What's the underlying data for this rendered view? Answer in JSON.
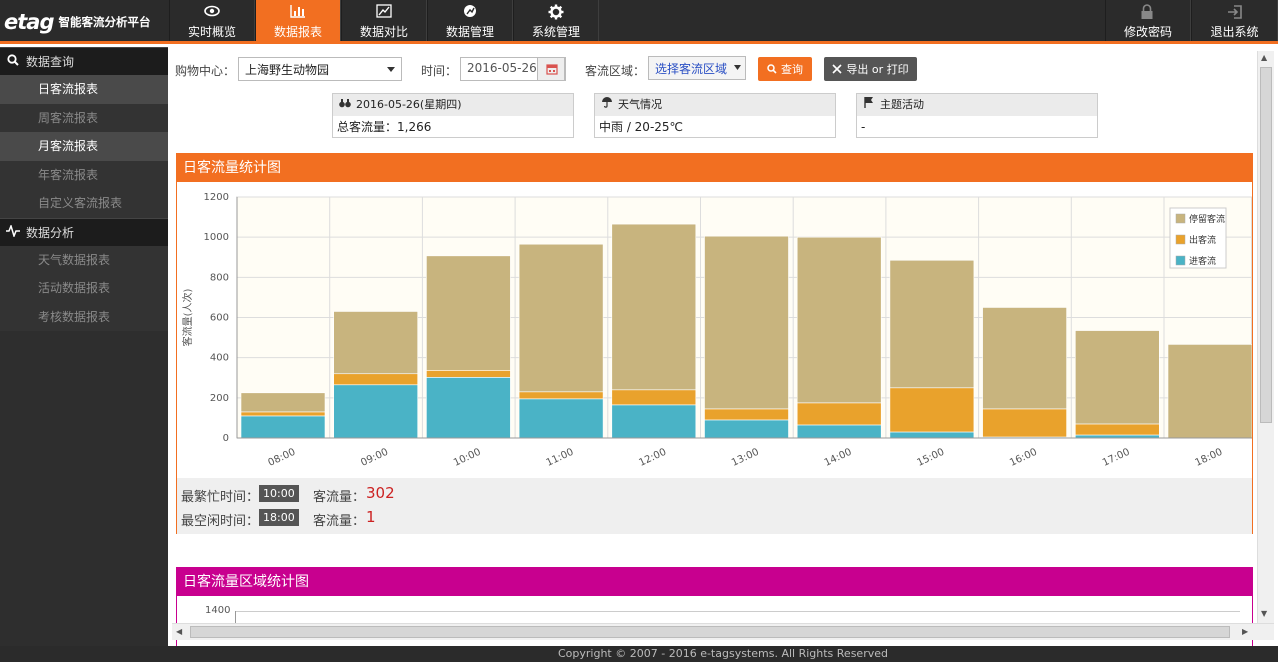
{
  "app": {
    "logo_mark": "etag",
    "logo_text": "智能客流分析平台"
  },
  "nav": {
    "items": [
      {
        "label": "实时概览",
        "icon": "eye-icon"
      },
      {
        "label": "数据报表",
        "icon": "bar-chart-icon",
        "active": true
      },
      {
        "label": "数据对比",
        "icon": "compare-icon"
      },
      {
        "label": "数据管理",
        "icon": "manage-icon"
      },
      {
        "label": "系统管理",
        "icon": "gear-icon"
      }
    ],
    "right": [
      {
        "label": "修改密码",
        "icon": "lock-icon"
      },
      {
        "label": "退出系统",
        "icon": "logout-icon"
      }
    ]
  },
  "sidebar": {
    "sections": [
      {
        "label": "数据查询",
        "icon": "search-icon",
        "items": [
          "日客流报表",
          "周客流报表",
          "月客流报表",
          "年客流报表",
          "自定义客流报表"
        ]
      },
      {
        "label": "数据分析",
        "icon": "pulse-icon",
        "items": [
          "天气数据报表",
          "活动数据报表",
          "考核数据报表"
        ]
      }
    ]
  },
  "filters": {
    "mall_label": "购物中心：",
    "mall_value": "上海野生动物园",
    "time_label": "时间：",
    "time_value": "2016-05-26",
    "area_label": "客流区域：",
    "area_value": "选择客流区域",
    "query_label": "查询",
    "export_label": "导出 or 打印"
  },
  "info": {
    "date_header": "2016-05-26(星期四)",
    "total_text": "总客流量：1,266",
    "weather_header": "天气情况",
    "weather_text": "中雨 / 20-25℃",
    "activity_header": "主题活动",
    "activity_text": "-"
  },
  "panel1": {
    "title": "日客流量统计图",
    "busiest_label": "最繁忙时间：",
    "busiest_time": "10:00",
    "busiest_count_label": "客流量：",
    "busiest_count": "302",
    "idlest_label": "最空闲时间：",
    "idlest_time": "18:00",
    "idlest_count_label": "客流量：",
    "idlest_count": "1"
  },
  "panel2": {
    "title": "日客流量区域统计图",
    "ytick_top": "1400"
  },
  "footer": {
    "text": "Copyright © 2007 - 2016 e-tagsystems. All Rights Reserved"
  },
  "colors": {
    "accent": "#f26f21",
    "magenta": "#c8008f",
    "stay": "#c8b47e",
    "out": "#e9a22c",
    "in": "#4ab3c6"
  },
  "chart_data": {
    "type": "bar",
    "stacked": true,
    "categories": [
      "08:00",
      "09:00",
      "10:00",
      "11:00",
      "12:00",
      "13:00",
      "14:00",
      "15:00",
      "16:00",
      "17:00",
      "18:00"
    ],
    "series": [
      {
        "name": "进客流",
        "color": "#4ab3c6",
        "values": [
          110,
          265,
          302,
          195,
          165,
          90,
          65,
          30,
          5,
          15,
          1
        ]
      },
      {
        "name": "出客流",
        "color": "#e9a22c",
        "values": [
          20,
          55,
          35,
          35,
          75,
          55,
          110,
          220,
          140,
          55,
          0
        ]
      },
      {
        "name": "停留客流",
        "color": "#c8b47e",
        "values": [
          95,
          310,
          570,
          735,
          825,
          860,
          825,
          635,
          505,
          465,
          465
        ]
      }
    ],
    "ylabel": "客流量(人次)",
    "ylim": [
      0,
      1200
    ],
    "yticks": [
      0,
      200,
      400,
      600,
      800,
      1000,
      1200
    ],
    "legend": "top-right",
    "grid": true
  }
}
